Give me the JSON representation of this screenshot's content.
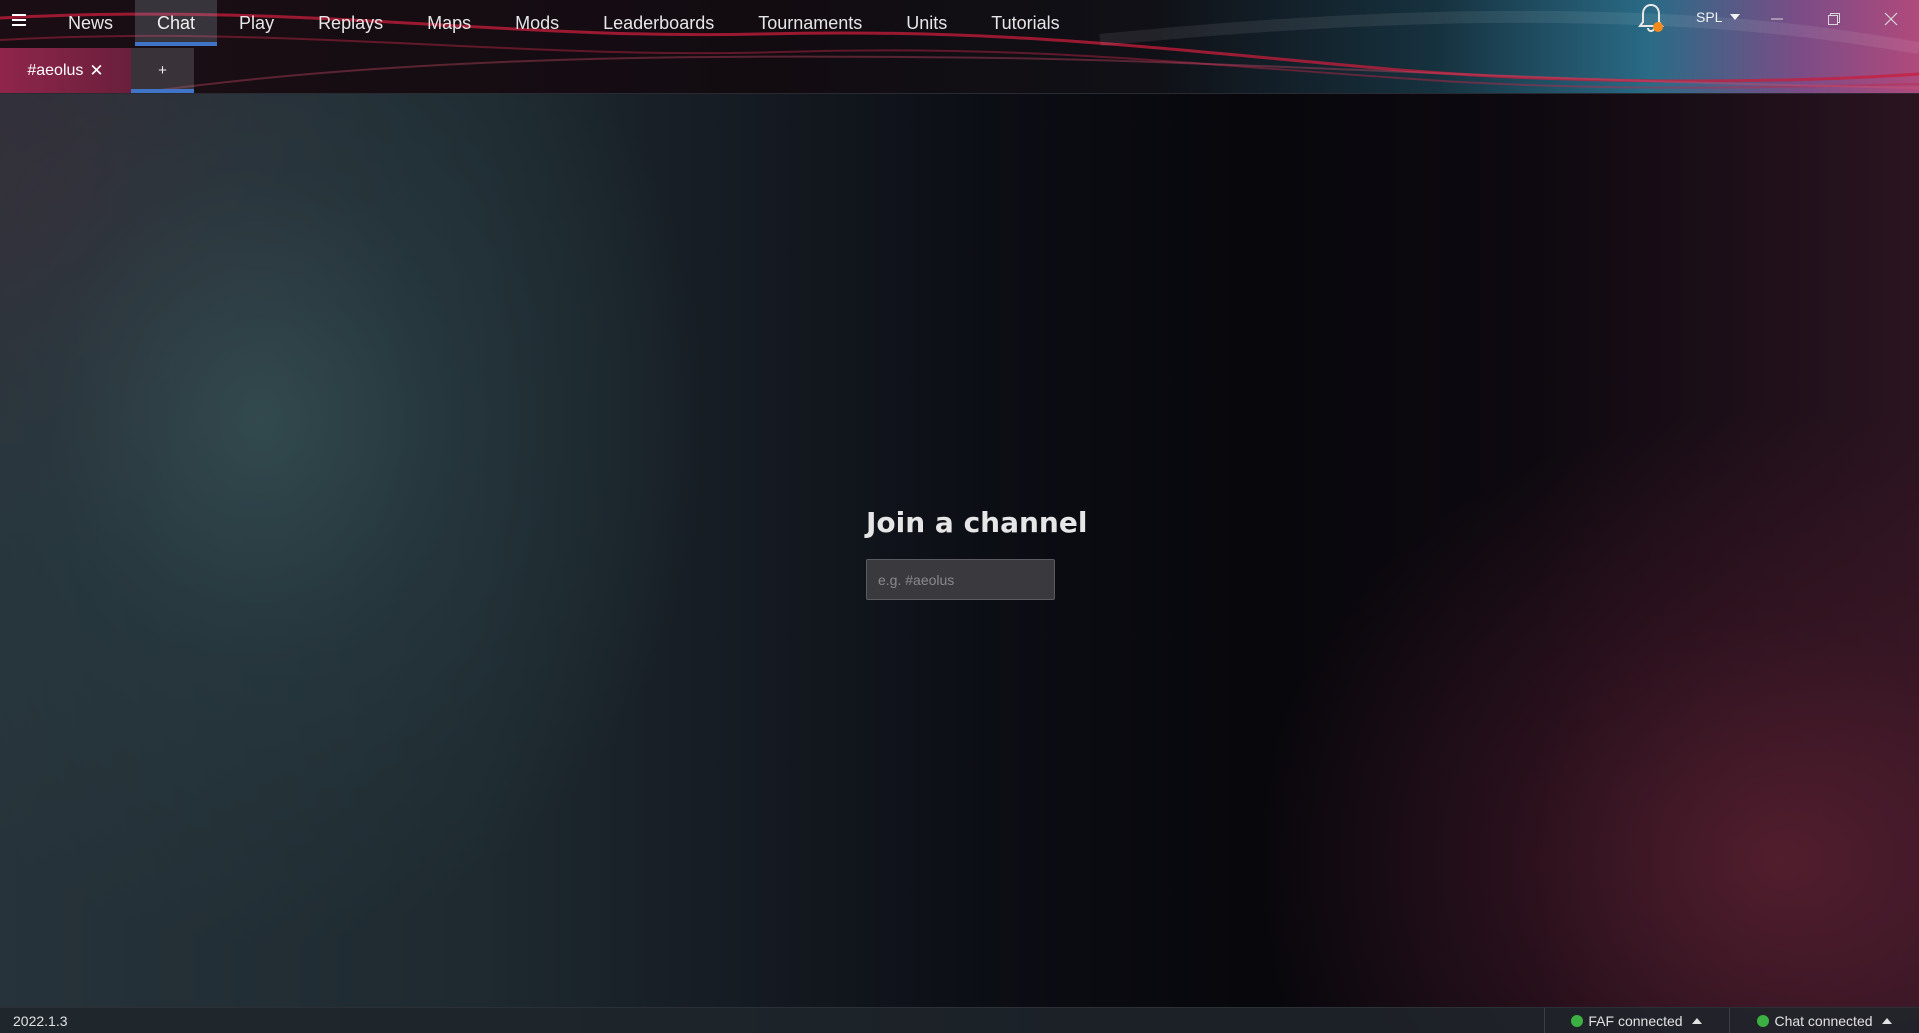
{
  "header": {
    "menu_icon": "hamburger-menu-icon",
    "tabs": [
      {
        "label": "News",
        "active": false
      },
      {
        "label": "Chat",
        "active": true
      },
      {
        "label": "Play",
        "active": false
      },
      {
        "label": "Replays",
        "active": false
      },
      {
        "label": "Maps",
        "active": false
      },
      {
        "label": "Mods",
        "active": false
      },
      {
        "label": "Leaderboards",
        "active": false
      },
      {
        "label": "Tournaments",
        "active": false
      },
      {
        "label": "Units",
        "active": false
      },
      {
        "label": "Tutorials",
        "active": false
      }
    ],
    "notification_icon": "bell-icon",
    "notification_badge_color": "#f08a1c",
    "username": "SPL",
    "window_controls": {
      "minimize_icon": "minimize-icon",
      "restore_icon": "restore-icon",
      "close_icon": "close-icon"
    }
  },
  "chat": {
    "channel_tabs": [
      {
        "label": "#aeolus",
        "close_symbol": "✕"
      }
    ],
    "add_tab_label": "+",
    "join": {
      "title": "Join a channel",
      "placeholder": "e.g. #aeolus"
    }
  },
  "status_bar": {
    "version": "2022.1.3",
    "faf_status": "FAF connected",
    "chat_status": "Chat connected",
    "connected_color": "#3cb043"
  },
  "colors": {
    "accent_blue": "#3f74c7",
    "channel_tab_pink": "#9c2850"
  }
}
